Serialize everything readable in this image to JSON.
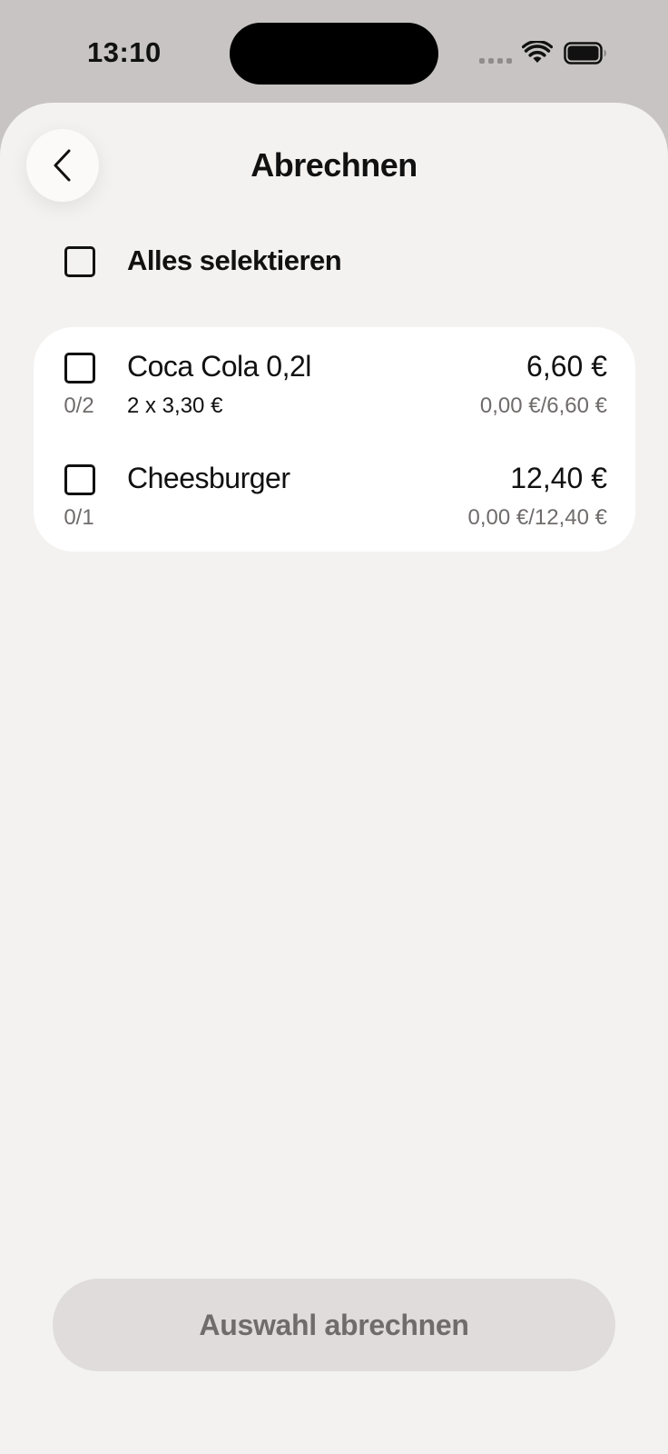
{
  "status_bar": {
    "time": "13:10",
    "icons": [
      "signal-dots-icon",
      "wifi-icon",
      "battery-icon"
    ]
  },
  "header": {
    "back_icon": "chevron-left-icon",
    "title": "Abrechnen"
  },
  "select_all": {
    "label": "Alles selektieren",
    "checked": false
  },
  "items": [
    {
      "name": "Coca Cola 0,2l",
      "detail": "2 x 3,30 €",
      "quantity": "0/2",
      "price": "6,60 €",
      "paid": "0,00 €/6,60 €",
      "checked": false
    },
    {
      "name": "Cheesburger",
      "detail": "",
      "quantity": "0/1",
      "price": "12,40 €",
      "paid": "0,00 €/12,40 €",
      "checked": false
    }
  ],
  "action": {
    "label": "Auswahl abrechnen",
    "enabled": false
  },
  "colors": {
    "background": "#f3f2f1",
    "card": "#ffffff",
    "button_disabled": "#dfdcdb",
    "muted_text": "#6f6c6b"
  }
}
